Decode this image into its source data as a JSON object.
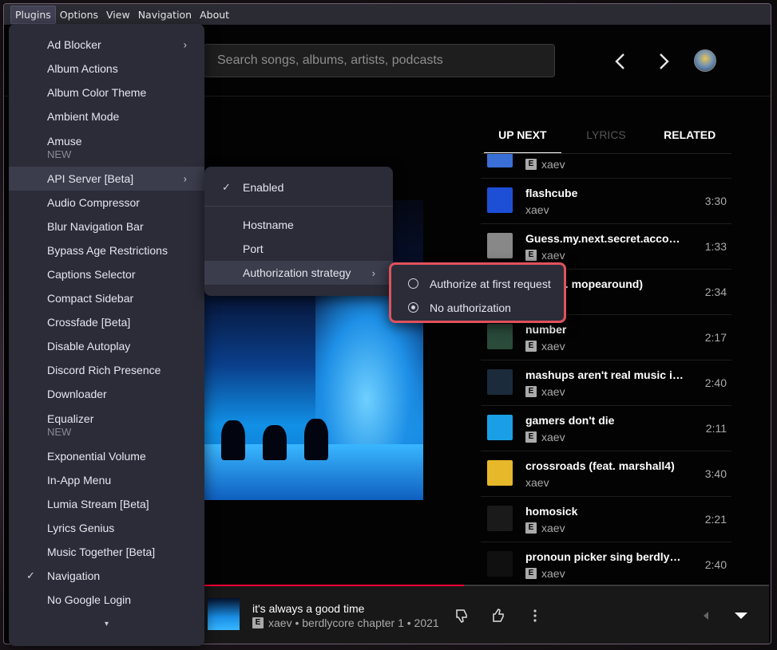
{
  "menubar": [
    "Plugins",
    "Options",
    "View",
    "Navigation",
    "About"
  ],
  "search": {
    "placeholder": "Search songs, albums, artists, podcasts"
  },
  "tabs": [
    {
      "label": "UP NEXT",
      "state": "active"
    },
    {
      "label": "LYRICS",
      "state": "disabled"
    },
    {
      "label": "RELATED",
      "state": "normal"
    }
  ],
  "queue": [
    {
      "title": "",
      "artist": "xaev",
      "explicit": true,
      "duration": "",
      "thumb_color": "#3a6fd8"
    },
    {
      "title": "flashcube",
      "artist": "xaev",
      "explicit": false,
      "duration": "3:30",
      "thumb_color": "#1d4fd6"
    },
    {
      "title": "Guess.my.next.secret.account",
      "artist": "xaev",
      "explicit": true,
      "duration": "1:33",
      "thumb_color": "#888888"
    },
    {
      "title": "da (feat. mopearound)",
      "artist": "",
      "explicit": false,
      "duration": "2:34",
      "thumb_color": "#444444"
    },
    {
      "title": "number",
      "artist": "xaev",
      "explicit": true,
      "duration": "2:17",
      "thumb_color": "#2a4a3a"
    },
    {
      "title": "mashups aren't real music im...",
      "artist": "xaev",
      "explicit": true,
      "duration": "2:40",
      "thumb_color": "#1b2b3b"
    },
    {
      "title": "gamers don't die",
      "artist": "xaev",
      "explicit": true,
      "duration": "2:11",
      "thumb_color": "#1a9fe6"
    },
    {
      "title": "crossroads (feat. marshall4)",
      "artist": "xaev",
      "explicit": false,
      "duration": "3:40",
      "thumb_color": "#e6b82a"
    },
    {
      "title": "homosick",
      "artist": "xaev",
      "explicit": true,
      "duration": "2:21",
      "thumb_color": "#1a1a1a"
    },
    {
      "title": "pronoun picker sing berdlycore",
      "artist": "xaev",
      "explicit": true,
      "duration": "2:40",
      "thumb_color": "#101010"
    }
  ],
  "player": {
    "title": "it's always a good time",
    "subtitle": "xaev • berdlycore chapter 1 • 2021",
    "explicit": true,
    "progress": 0.46
  },
  "plugins_menu": [
    {
      "label": "Ad Blocker",
      "submenu": true
    },
    {
      "label": "Album Actions"
    },
    {
      "label": "Album Color Theme"
    },
    {
      "label": "Ambient Mode"
    },
    {
      "label": "Amuse",
      "note": "NEW"
    },
    {
      "label": "API Server [Beta]",
      "submenu": true,
      "highlighted": true
    },
    {
      "label": "Audio Compressor"
    },
    {
      "label": "Blur Navigation Bar"
    },
    {
      "label": "Bypass Age Restrictions"
    },
    {
      "label": "Captions Selector"
    },
    {
      "label": "Compact Sidebar"
    },
    {
      "label": "Crossfade [Beta]"
    },
    {
      "label": "Disable Autoplay"
    },
    {
      "label": "Discord Rich Presence"
    },
    {
      "label": "Downloader"
    },
    {
      "label": "Equalizer",
      "note": "NEW"
    },
    {
      "label": "Exponential Volume"
    },
    {
      "label": "In-App Menu"
    },
    {
      "label": "Lumia Stream [Beta]"
    },
    {
      "label": "Lyrics Genius"
    },
    {
      "label": "Music Together [Beta]"
    },
    {
      "label": "Navigation",
      "checked": true
    },
    {
      "label": "No Google Login"
    }
  ],
  "api_submenu": {
    "enabled_label": "Enabled",
    "hostname_label": "Hostname",
    "port_label": "Port",
    "auth_label": "Authorization strategy"
  },
  "auth_submenu": [
    {
      "label": "Authorize at first request",
      "selected": false
    },
    {
      "label": "No authorization",
      "selected": true
    }
  ]
}
